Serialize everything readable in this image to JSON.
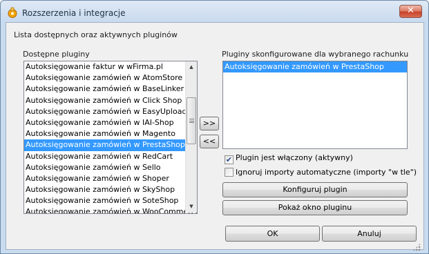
{
  "window": {
    "title": "Rozszerzenia i integracje",
    "close_glyph": "✕"
  },
  "header": {
    "description": "Lista dostępnych oraz aktywnych pluginów"
  },
  "available": {
    "label": "Dostępne pluginy",
    "items": [
      "Autoksięgowanie faktur w wFirma.pl",
      "Autoksięgowanie zamówień w AtomStore",
      "Autoksięgowanie zamówień w BaseLinker",
      "Autoksięgowanie zamówień w Click Shop",
      "Autoksięgowanie zamówień w EasyUploader",
      "Autoksięgowanie zamówień w IAI-Shop",
      "Autoksięgowanie zamówień w Magento",
      "Autoksięgowanie zamówień w PrestaShop",
      "Autoksięgowanie zamówień w RedCart",
      "Autoksięgowanie zamówień w Sello",
      "Autoksięgowanie zamówień w Shoper",
      "Autoksięgowanie zamówień w SkyShop",
      "Autoksięgowanie zamówień w SoteShop",
      "Autoksięgowanie zamówień w WooCommerce"
    ],
    "selected_index": 7
  },
  "configured": {
    "label": "Pluginy skonfigurowane dla wybranego rachunku",
    "items": [
      "Autoksięgowanie zamówień w PrestaShop"
    ],
    "selected_index": 0
  },
  "transfer": {
    "add_label": ">>",
    "remove_label": "<<"
  },
  "options": {
    "enabled_label": "Plugin jest włączony (aktywny)",
    "enabled_checked": true,
    "ignore_label": "Ignoruj importy automatyczne (importy \"w tle\")",
    "ignore_checked": false
  },
  "buttons": {
    "configure": "Konfiguruj plugin",
    "show_window": "Pokaż okno pluginu",
    "ok": "OK",
    "cancel": "Anuluj"
  },
  "icons": {
    "app": "plugin-app-icon",
    "check": "✔",
    "scroll_up": "▲",
    "scroll_down": "▼"
  }
}
